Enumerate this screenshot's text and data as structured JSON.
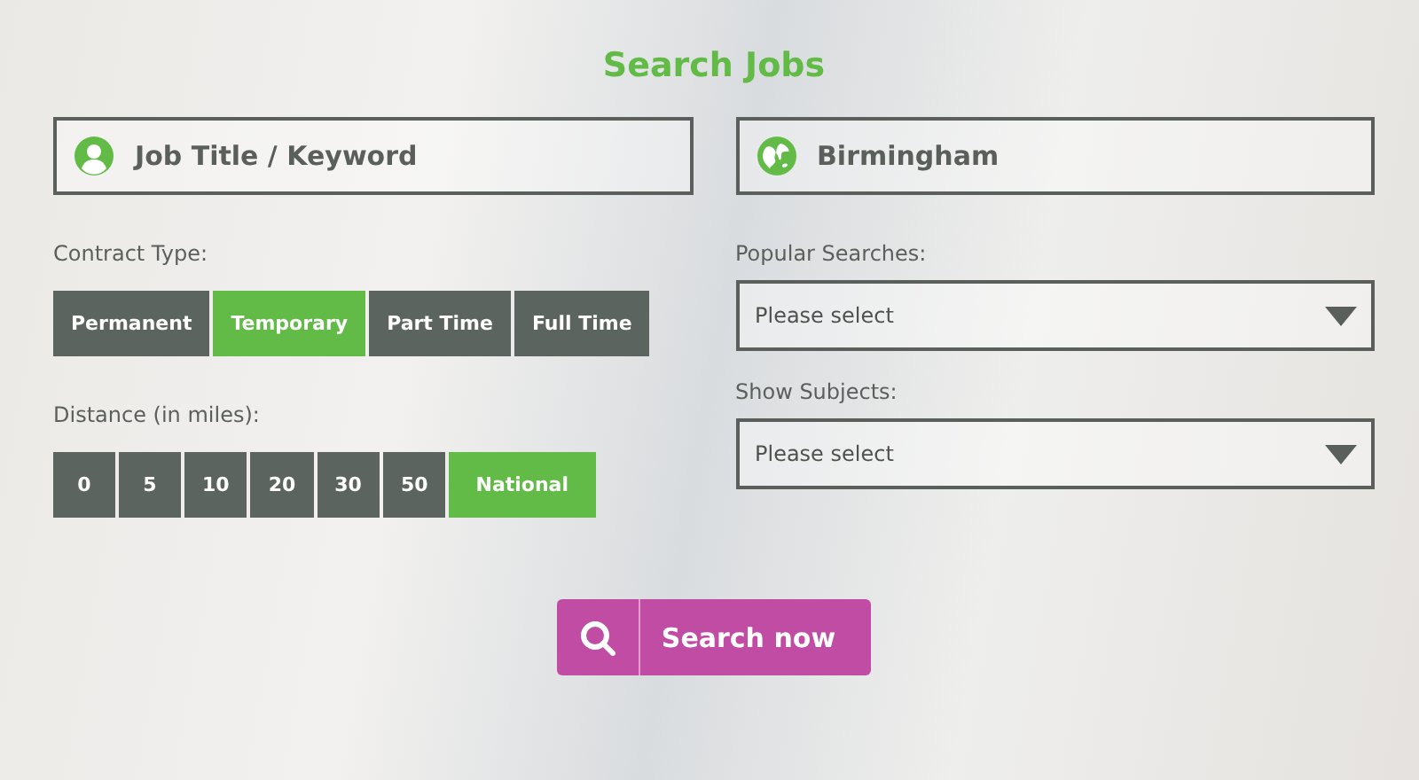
{
  "title": "Search Jobs",
  "keyword": {
    "placeholder": "Job Title / Keyword"
  },
  "location": {
    "value": "Birmingham"
  },
  "contract_type": {
    "label": "Contract Type:",
    "options": [
      {
        "label": "Permanent",
        "selected": false
      },
      {
        "label": "Temporary",
        "selected": true
      },
      {
        "label": "Part Time",
        "selected": false
      },
      {
        "label": "Full Time",
        "selected": false
      }
    ]
  },
  "distance": {
    "label": "Distance (in miles):",
    "options": [
      {
        "label": "0",
        "selected": false
      },
      {
        "label": "5",
        "selected": false
      },
      {
        "label": "10",
        "selected": false
      },
      {
        "label": "20",
        "selected": false
      },
      {
        "label": "30",
        "selected": false
      },
      {
        "label": "50",
        "selected": false
      },
      {
        "label": "National",
        "selected": true
      }
    ]
  },
  "popular_searches": {
    "label": "Popular Searches:",
    "value": "Please select"
  },
  "show_subjects": {
    "label": "Show Subjects:",
    "value": "Please select"
  },
  "search_button": {
    "label": "Search now"
  }
}
